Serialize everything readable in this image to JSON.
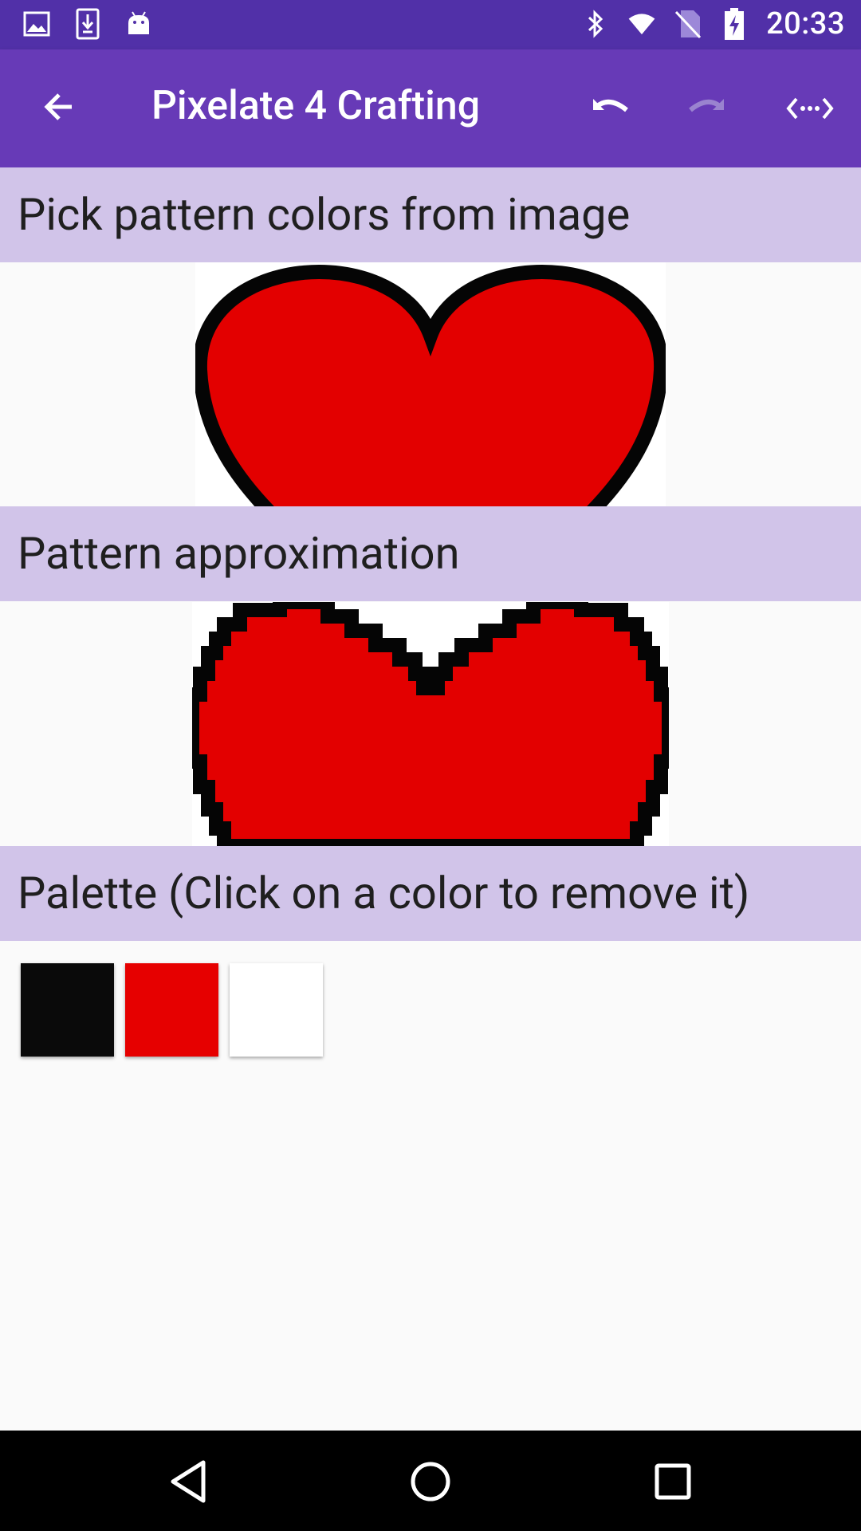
{
  "status_bar": {
    "time": "20:33",
    "left_icons": [
      "image-icon",
      "download-icon",
      "android-icon"
    ],
    "right_icons": [
      "bluetooth-icon",
      "wifi-icon",
      "no-sim-icon",
      "battery-charging-icon"
    ]
  },
  "app_bar": {
    "title": "Pixelate 4 Crafting",
    "back_icon": "arrow-back-icon",
    "actions": [
      "undo-icon",
      "redo-icon",
      "resize-icon"
    ],
    "redo_enabled": false
  },
  "sections": {
    "pick": {
      "label": "Pick pattern colors from image"
    },
    "approx": {
      "label": "Pattern approximation"
    },
    "palette": {
      "label": "Palette (Click on a color to remove it)"
    }
  },
  "palette": {
    "colors": [
      "#0a0a0a",
      "#e60000",
      "#ffffff"
    ]
  },
  "nav_bar": {
    "buttons": [
      "nav-back-icon",
      "nav-home-icon",
      "nav-recent-icon"
    ]
  }
}
